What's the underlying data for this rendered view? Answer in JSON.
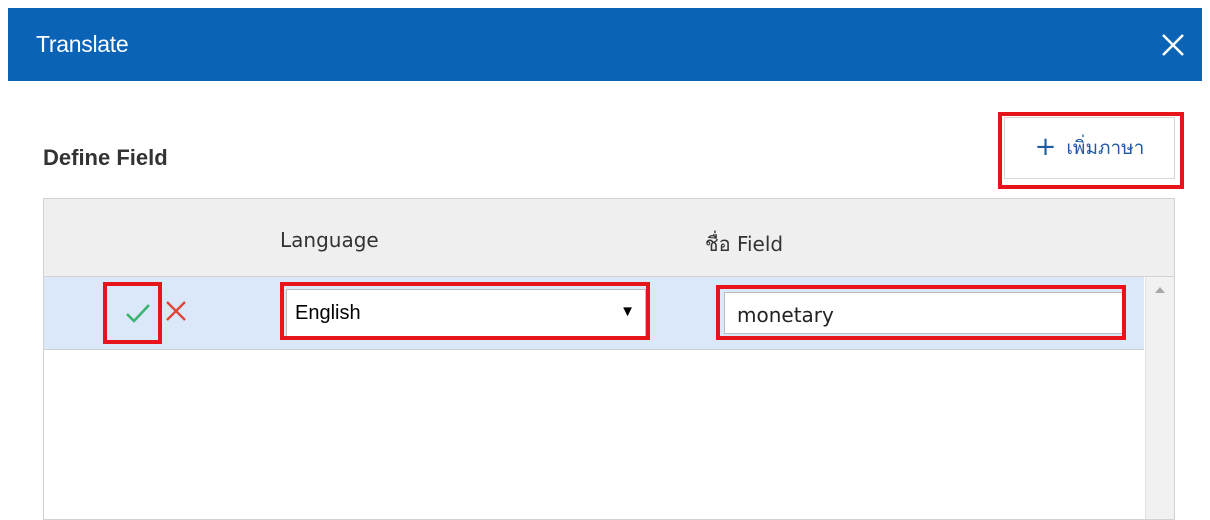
{
  "dialog": {
    "title": "Translate"
  },
  "section": {
    "title": "Define Field"
  },
  "add_language_button": {
    "label": "เพิ่มภาษา"
  },
  "table": {
    "columns": [
      "",
      "Language",
      "ชื่อ Field"
    ],
    "rows": [
      {
        "language": "English",
        "field_name": "monetary"
      }
    ]
  },
  "icons": {
    "close": "close-icon",
    "add": "plus-icon",
    "confirm": "check-icon",
    "cancel": "x-icon",
    "dropdown": "dropdown-arrow-icon"
  },
  "colors": {
    "titlebar": "#0b63b5",
    "confirm": "#3cb371",
    "cancel": "#e0453a",
    "highlight": "#e8141b",
    "selected_row": "#dbe8fa"
  }
}
